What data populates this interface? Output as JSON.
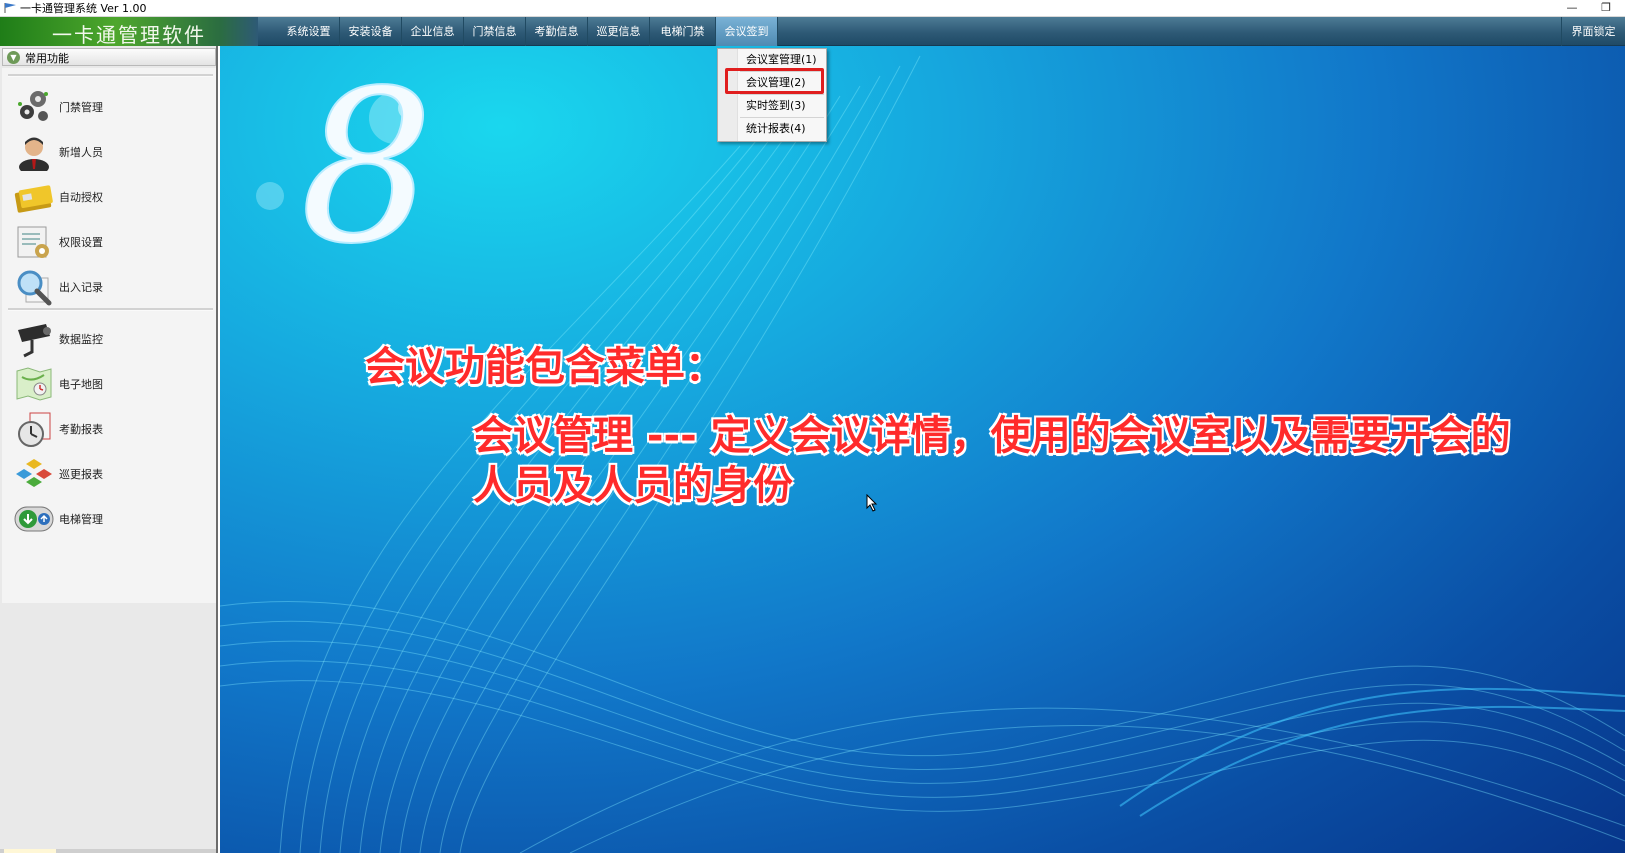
{
  "window": {
    "title": "一卡通管理系统  Ver 1.00",
    "minimize_glyph": "—",
    "restore_glyph": "❐"
  },
  "menubar": {
    "brand": "一卡通管理软件",
    "items": [
      {
        "label": "系统设置"
      },
      {
        "label": "安装设备"
      },
      {
        "label": "企业信息"
      },
      {
        "label": "门禁信息"
      },
      {
        "label": "考勤信息"
      },
      {
        "label": "巡更信息"
      },
      {
        "label": "电梯门禁"
      },
      {
        "label": "会议签到"
      }
    ],
    "lock_label": "界面锁定"
  },
  "dropdown": {
    "items": [
      {
        "label": "会议室管理(1)"
      },
      {
        "label": "会议管理(2)"
      },
      {
        "label": "实时签到(3)"
      },
      {
        "label": "统计报表(4)"
      }
    ],
    "highlight_color": "#e01e1e"
  },
  "sidebar": {
    "header": "常用功能",
    "items": [
      {
        "label": "门禁管理",
        "icon": "gears-icon"
      },
      {
        "label": "新增人员",
        "icon": "person-icon"
      },
      {
        "label": "自动授权",
        "icon": "card-icon"
      },
      {
        "label": "权限设置",
        "icon": "clipboard-icon"
      },
      {
        "label": "出入记录",
        "icon": "magnifier-icon"
      },
      {
        "label": "数据监控",
        "icon": "camera-icon"
      },
      {
        "label": "电子地图",
        "icon": "map-icon"
      },
      {
        "label": "考勤报表",
        "icon": "clock-icon"
      },
      {
        "label": "巡更报表",
        "icon": "blocks-icon"
      },
      {
        "label": "电梯管理",
        "icon": "elevator-icon"
      }
    ]
  },
  "main": {
    "logo_glyph": "8",
    "overlay_title": "会议功能包含菜单：",
    "overlay_desc": "会议管理 --- 定义会议详情，使用的会议室以及需要开会的人员及人员的身份",
    "text_color": "#ff2b2b"
  }
}
